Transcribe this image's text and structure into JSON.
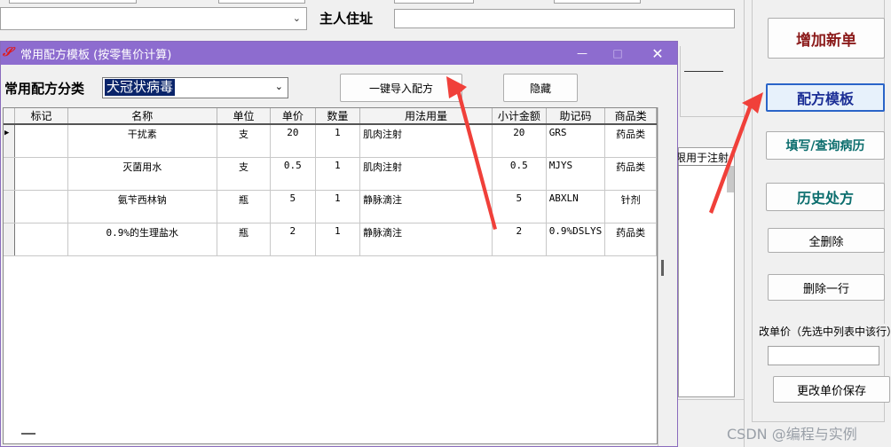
{
  "main": {
    "owner_address_label": "主人住址",
    "right_buttons": {
      "add_new": "增加新单",
      "template": "配方模板",
      "fill_query": "填写/查询病历",
      "history": "历史处方",
      "delete_all": "全删除",
      "delete_row": "删除一行",
      "price_hint": "改单价（先选中列表中该行）",
      "save_price": "更改单价保存"
    },
    "behind_header_fragment": "限用于注射"
  },
  "dialog": {
    "title": "常用配方模板 (按零售价计算)",
    "category_label": "常用配方分类",
    "category_value": "犬冠状病毒",
    "import_button": "一键导入配方",
    "hide_button": "隐藏",
    "columns": [
      "标记",
      "名称",
      "单位",
      "单价",
      "数量",
      "用法用量",
      "小计金额",
      "助记码",
      "商品类"
    ],
    "rows": [
      {
        "mark": "",
        "name": "干扰素",
        "unit": "支",
        "price": "20",
        "qty": "1",
        "usage": "肌肉注射",
        "subtotal": "20",
        "code": "GRS",
        "type": "药品类"
      },
      {
        "mark": "",
        "name": "灭菌用水",
        "unit": "支",
        "price": "0.5",
        "qty": "1",
        "usage": "肌肉注射",
        "subtotal": "0.5",
        "code": "MJYS",
        "type": "药品类"
      },
      {
        "mark": "",
        "name": "氨苄西林钠",
        "unit": "瓶",
        "price": "5",
        "qty": "1",
        "usage": "静脉滴注",
        "subtotal": "5",
        "code": "ABXLN",
        "type": "针剂"
      },
      {
        "mark": "",
        "name": "0.9%的生理盐水",
        "unit": "瓶",
        "price": "2",
        "qty": "1",
        "usage": "静脉滴注",
        "subtotal": "2",
        "code": "0.9%DSLYS",
        "type": "药品类"
      }
    ]
  },
  "watermark": "CSDN @编程与实例",
  "colors": {
    "titlebar": "#8d6ccf",
    "arrow": "#f0403a",
    "add_new": "#8b1a1a",
    "blue_btn": "#1c2f96",
    "teal_btn": "#0c6e6e",
    "selection": "#0a246a"
  }
}
